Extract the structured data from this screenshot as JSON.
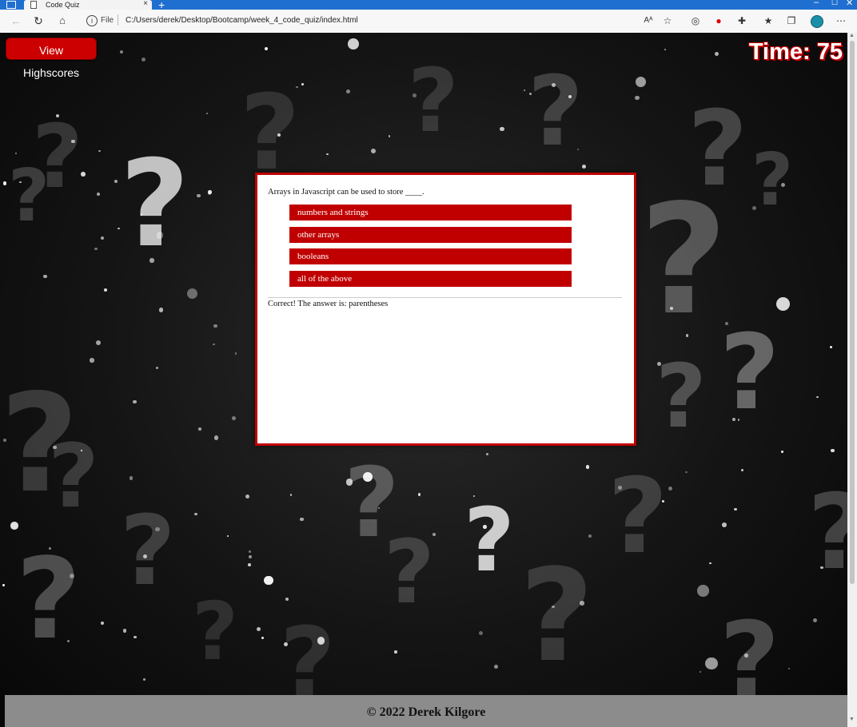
{
  "browser": {
    "tab_title": "Code Quiz",
    "tab_close": "×",
    "new_tab": "+",
    "scheme_label": "File",
    "address": "C:/Users/derek/Desktop/Bootcamp/week_4_code_quiz/index.html"
  },
  "page": {
    "highscores_label": "View Highscores",
    "timer_label": "Time: 75",
    "quiz": {
      "question": "Arrays in Javascript can be used to store ____.",
      "answers": [
        "numbers and strings",
        "other arrays",
        "booleans",
        "all of the above"
      ],
      "feedback": "Correct! The answer is: parentheses"
    },
    "footer": "© 2022 Derek Kilgore"
  },
  "colors": {
    "accent": "#cc0000",
    "browser_tab_bar": "#1f6fd0",
    "footer_bg": "#8c8c8c"
  },
  "icons": [
    "tab-menu-icon",
    "page-icon",
    "close-icon",
    "back-icon",
    "refresh-icon",
    "home-icon",
    "info-icon",
    "read-aloud-icon",
    "favorite-add-icon",
    "tracking-icon",
    "extension-opera-icon",
    "extensions-icon",
    "favorites-icon",
    "collections-icon",
    "profile-icon",
    "more-icon",
    "minimize-icon",
    "maximize-icon"
  ]
}
